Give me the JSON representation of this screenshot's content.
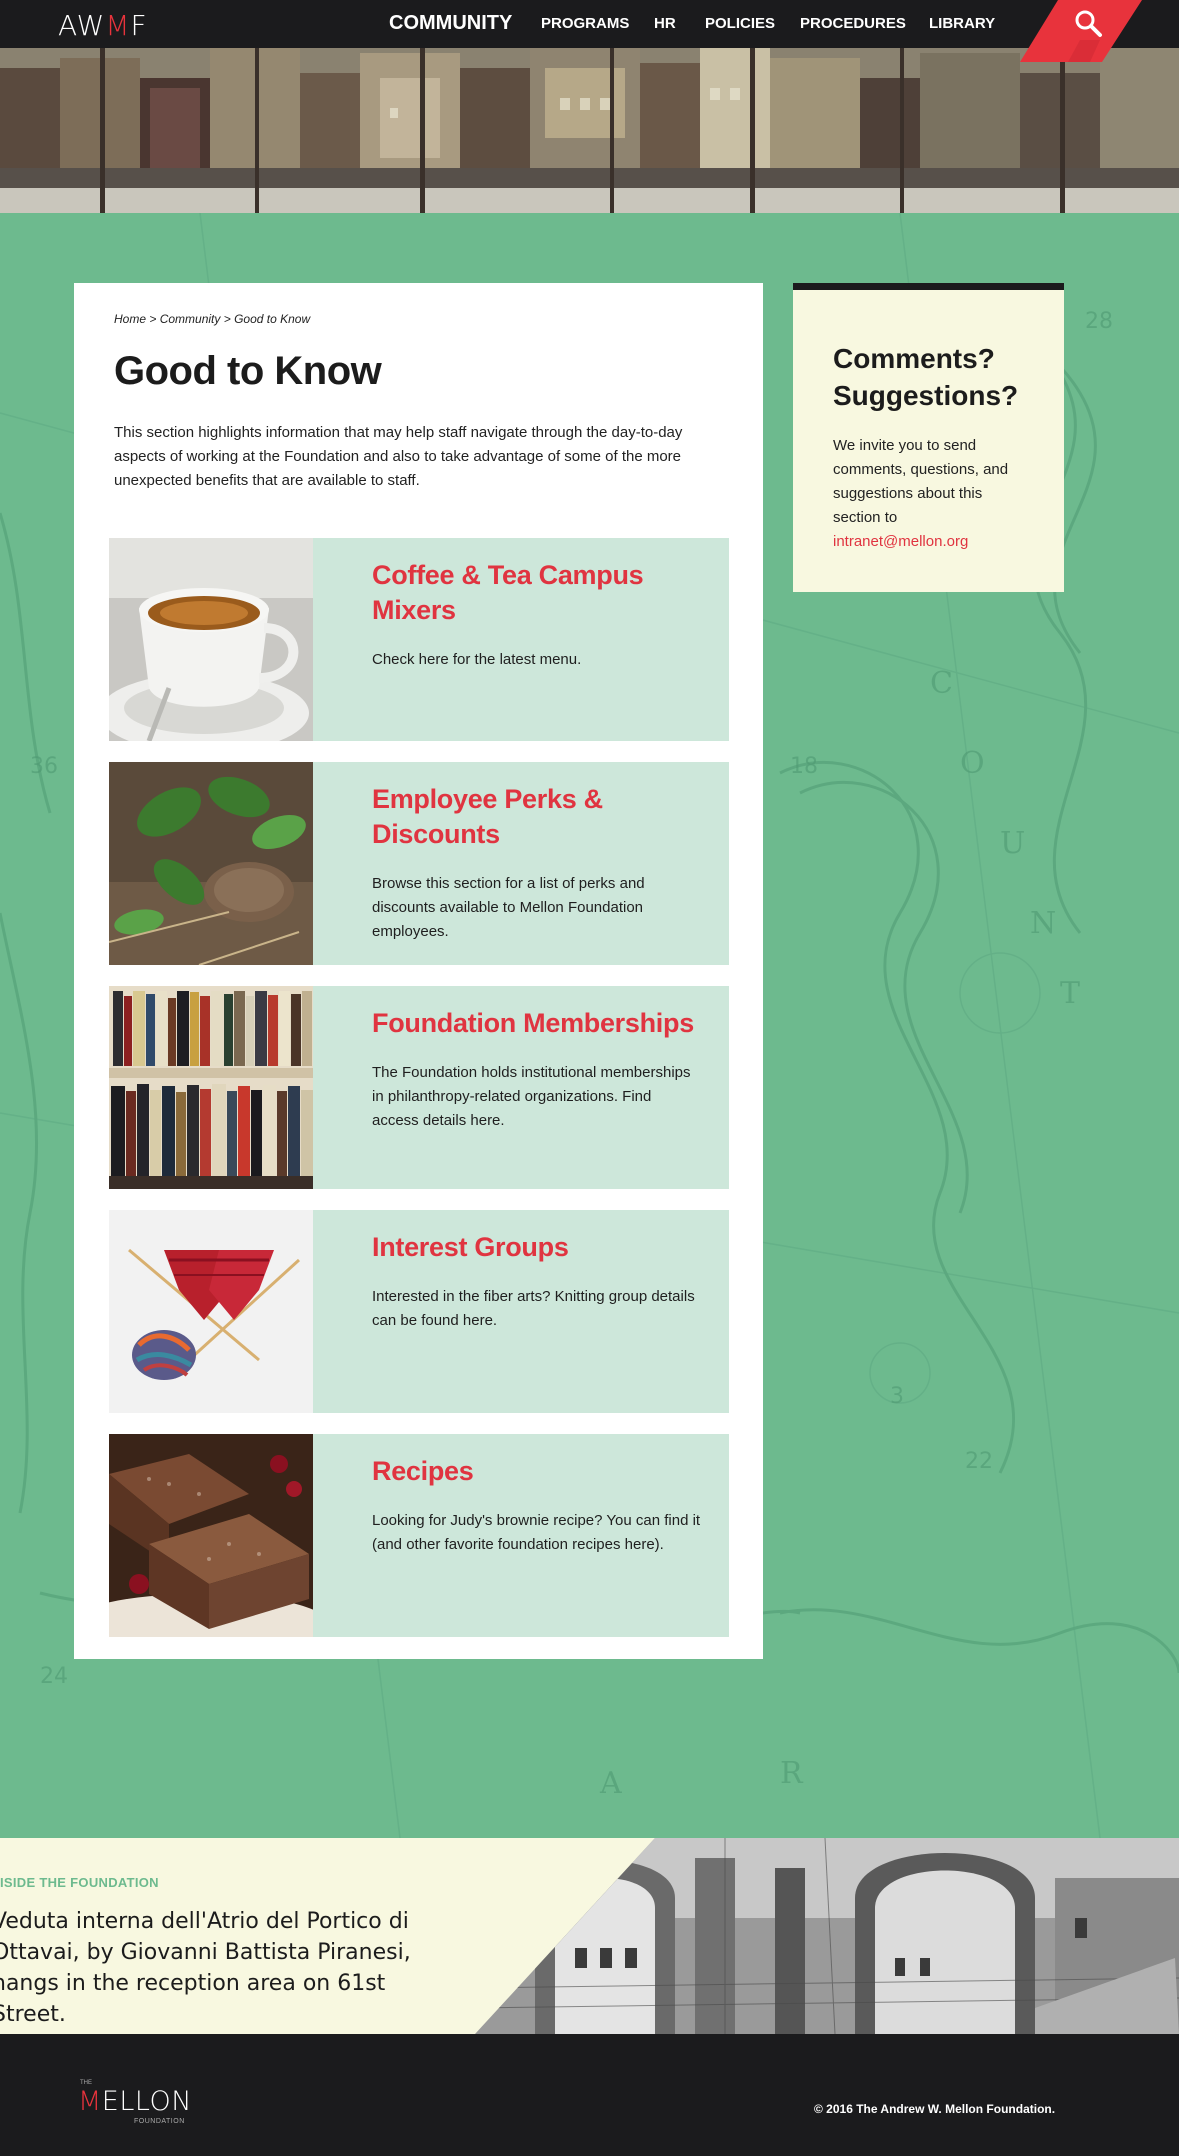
{
  "header": {
    "logo_text": "AWMF",
    "nav": [
      "COMMUNITY",
      "PROGRAMS",
      "HR",
      "POLICIES",
      "PROCEDURES",
      "LIBRARY"
    ],
    "search_icon": "search-icon",
    "accent_color": "#e8333c"
  },
  "breadcrumb": {
    "home": "Home",
    "sep1": " > ",
    "community": "Community",
    "sep2": " > ",
    "current": "Good to Know"
  },
  "main": {
    "title": "Good to Know",
    "intro": "This section highlights information that may help staff navigate through the day-to-day aspects of working at the Foundation and also to take advantage of some of the more unexpected benefits that are available to staff.",
    "items": [
      {
        "title": "Coffee & Tea Campus Mixers",
        "description": "Check here for the latest menu."
      },
      {
        "title": "Employee Perks & Discounts",
        "description": "Browse this section for a list of perks and discounts available to Mellon Foundation employees."
      },
      {
        "title": "Foundation Memberships",
        "description": "The Foundation holds institutional memberships in philanthropy-related organizations.  Find access details here."
      },
      {
        "title": "Interest Groups",
        "description": "Interested in the fiber arts?  Knitting group details can be found here."
      },
      {
        "title": "Recipes",
        "description": "Looking for Judy's brownie recipe?  You can find it (and other favorite foundation recipes here)."
      }
    ]
  },
  "sidebar": {
    "title": "Comments? Suggestions?",
    "text": "We invite you to send comments, questions, and suggestions about this section to",
    "email": "intranet@mellon.org"
  },
  "inside": {
    "kicker": "ISIDE THE FOUNDATION",
    "text": "Veduta interna dell'Atrio del Portico di Ottavai, by Giovanni Battista Piranesi, hangs in the reception area on 61st Street."
  },
  "footer": {
    "logo_the": "THE",
    "logo_word": "MELLON",
    "logo_sub": "FOUNDATION",
    "copyright": "© 2016 The Andrew W. Mellon Foundation."
  }
}
